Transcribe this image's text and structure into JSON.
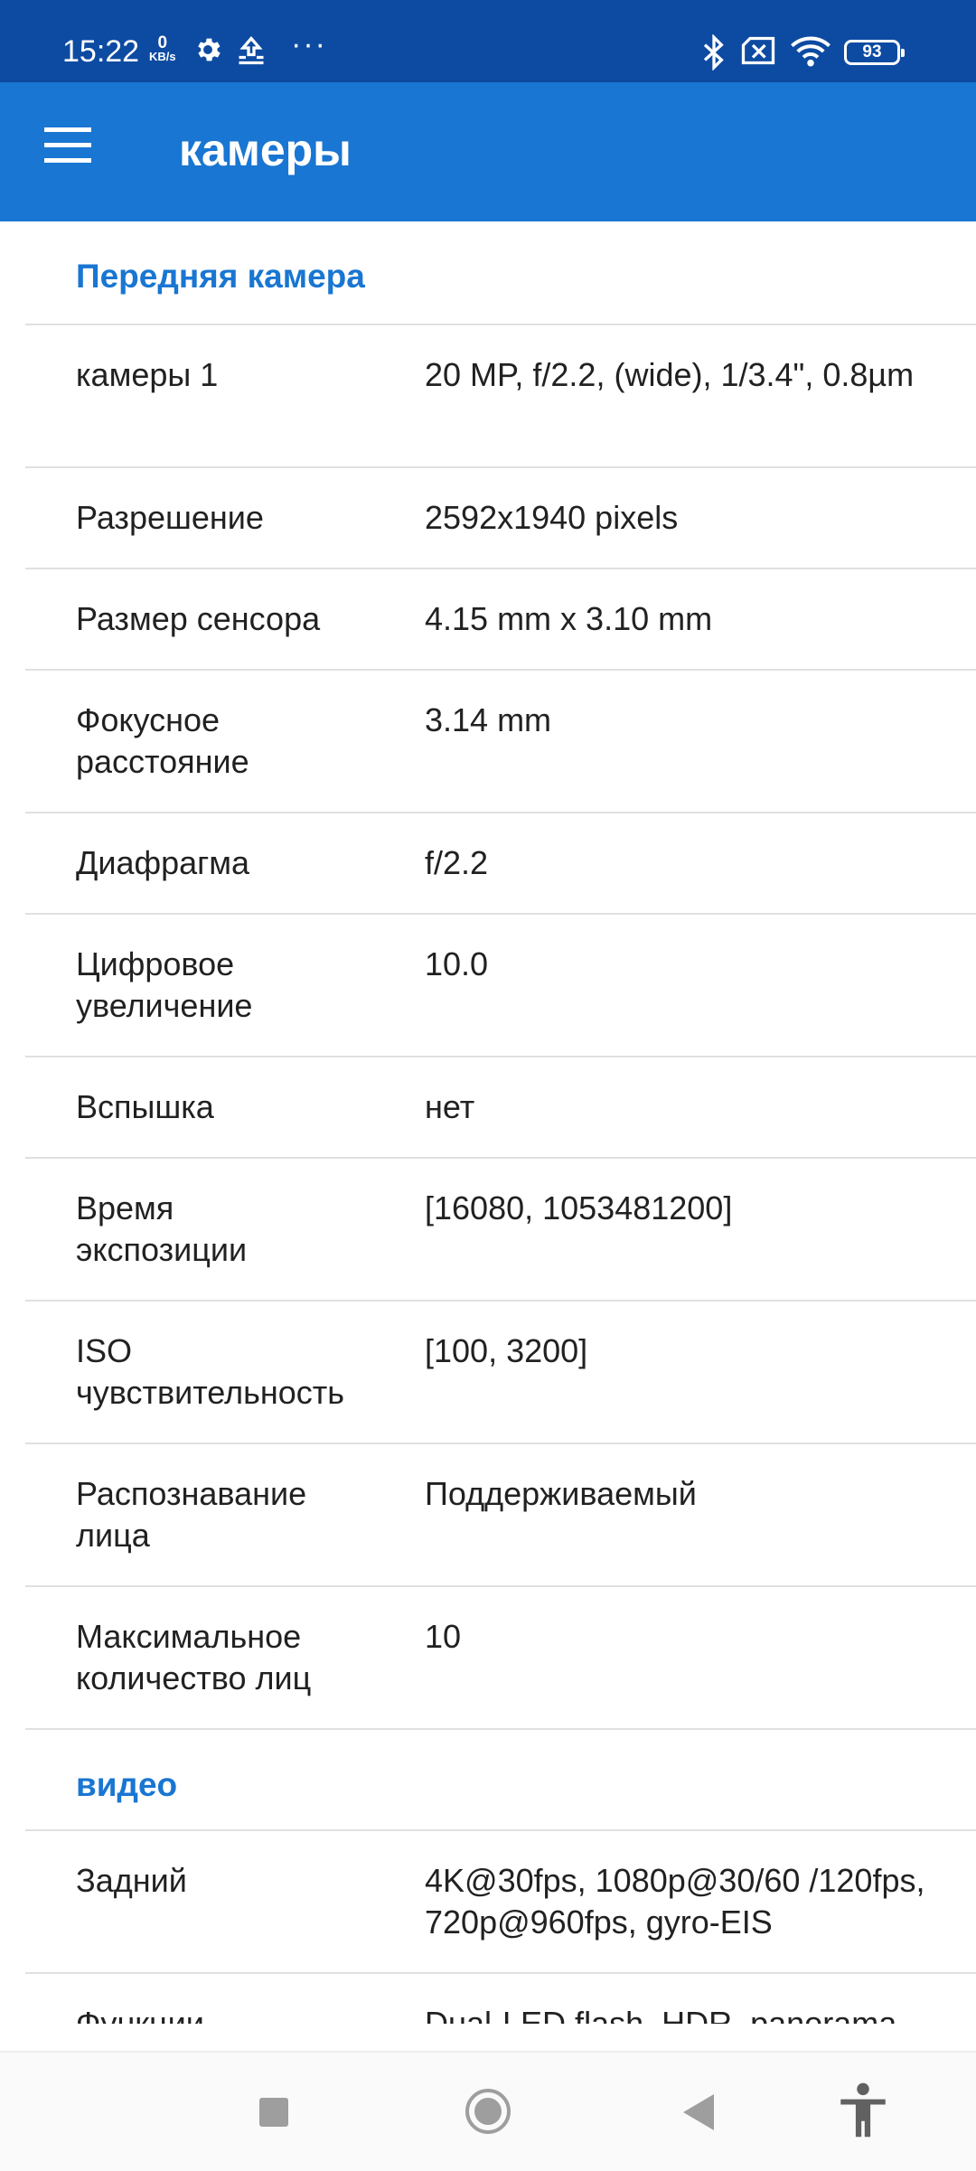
{
  "status_bar": {
    "time": "15:22",
    "net_speed_value": "0",
    "net_speed_unit": "KB/s",
    "icons": [
      "gear-icon",
      "upload-icon",
      "more-dots-icon",
      "bluetooth-icon",
      "sim-off-icon",
      "wifi-icon"
    ],
    "more": "···",
    "battery": "93"
  },
  "app_bar": {
    "title": "камеры",
    "menu_icon": "hamburger-menu-icon"
  },
  "colors": {
    "status_bar": "#0d4ba2",
    "app_bar": "#1976d2",
    "section_header": "#1976d2",
    "divider": "#e0e0e0"
  },
  "sections": [
    {
      "title": "Передняя камера",
      "rows": [
        {
          "label": "камеры 1",
          "value": "20 MP, f/2.2, (wide), 1/3.4\", 0.8µm"
        },
        {
          "label": "Разрешение",
          "value": "2592x1940 pixels"
        },
        {
          "label": "Размер сенсора",
          "value": "4.15 mm x 3.10 mm"
        },
        {
          "label": "Фокусное расстояние",
          "value": "3.14 mm"
        },
        {
          "label": "Диафрагма",
          "value": "f/2.2"
        },
        {
          "label": "Цифровое увеличение",
          "value": "10.0"
        },
        {
          "label": "Вспышка",
          "value": "нет"
        },
        {
          "label": "Время экспозиции",
          "value": "[16080, 1053481200]"
        },
        {
          "label": "ISO чувствительность",
          "value": "[100, 3200]"
        },
        {
          "label": "Распознавание лица",
          "value": "Поддерживаемый"
        },
        {
          "label": "Максимальное количество лиц",
          "value": "10"
        }
      ]
    },
    {
      "title": "видео",
      "rows": [
        {
          "label": "Задний",
          "value": "4K@30fps, 1080p@30/60 /120fps, 720p@960fps, gyro-EIS"
        },
        {
          "label": "Функции",
          "value": "Dual-LED flash, HDR, panorama"
        }
      ]
    }
  ],
  "nav_bar": {
    "icons": [
      "recents-square-icon",
      "home-circle-icon",
      "back-triangle-icon",
      "accessibility-icon"
    ]
  }
}
